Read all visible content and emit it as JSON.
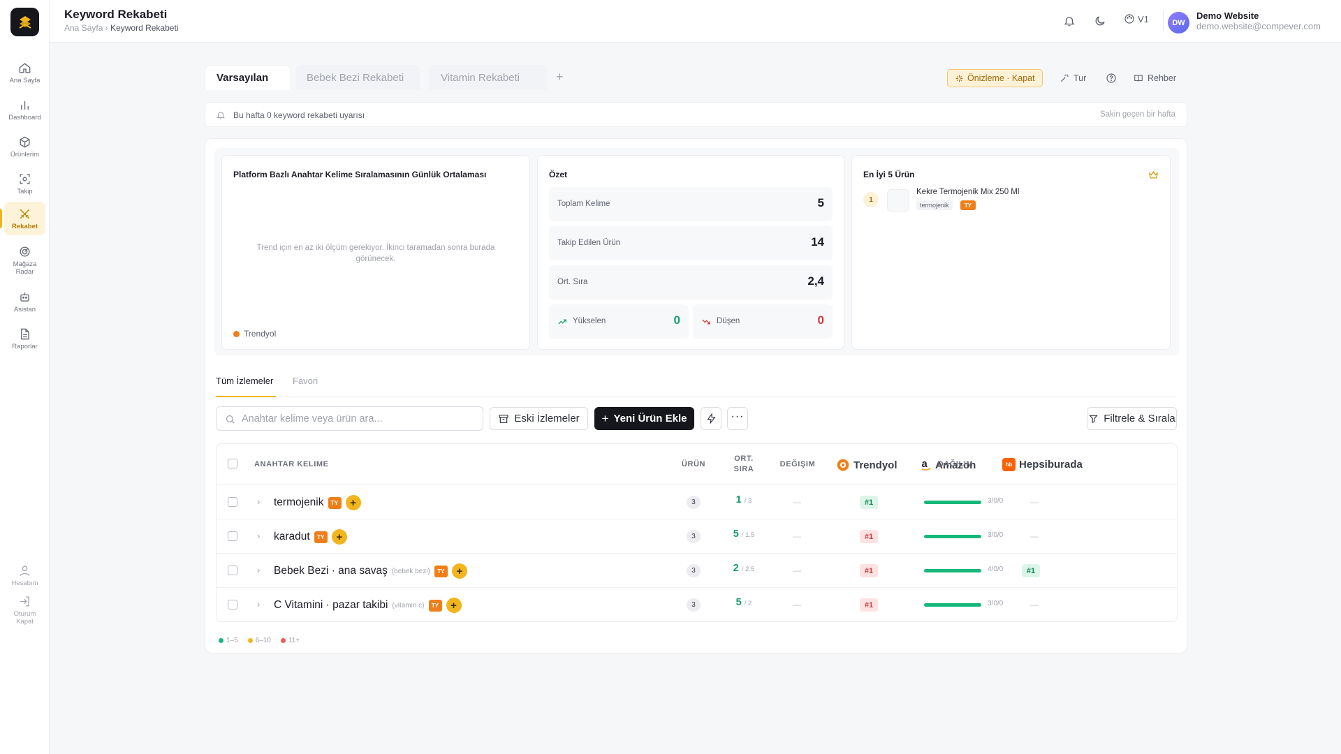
{
  "app": {
    "title": "Keyword Rekabeti"
  },
  "breadcrumb": [
    "Ana Sayfa",
    "Keyword Rekabeti"
  ],
  "sidebar": {
    "items": [
      {
        "label": "Ana Sayfa",
        "icon": "home-icon"
      },
      {
        "label": "Dashboard",
        "icon": "bar-chart-icon"
      },
      {
        "label": "Ürünlerim",
        "icon": "box-icon"
      },
      {
        "label": "Takip",
        "icon": "scan-icon"
      },
      {
        "label": "Rekabet",
        "icon": "swords-icon",
        "active": true
      },
      {
        "label": "Mağaza Radar",
        "icon": "radar-icon"
      },
      {
        "label": "Asistan",
        "icon": "bot-icon"
      },
      {
        "label": "Raporlar",
        "icon": "file-icon"
      }
    ],
    "bottom": [
      {
        "label": "Hesabım",
        "icon": "user-icon"
      },
      {
        "label": "Oturum Kapat",
        "icon": "logout-icon"
      }
    ]
  },
  "topbar": {
    "lang": "V1",
    "user_initials": "DW",
    "user_name": "Demo Website",
    "user_email": "demo.website@compever.com"
  },
  "view_tabs": [
    "Varsayılan",
    "Bebek Bezi Rekabeti",
    "Vitamin Rekabeti"
  ],
  "actions": {
    "preview": "Önizleme · Kapat",
    "tour": "Tur",
    "guide": "Rehber"
  },
  "alert": {
    "text": "Bu hafta 0 keyword rekabeti uyarısı",
    "sub": "Sakin geçen bir hafta"
  },
  "chart_panel": {
    "title": "Platform Bazlı Anahtar Kelime Sıralamasının Günlük Ortalaması",
    "empty": "Trend için en az iki ölçüm gerekiyor. İkinci taramadan sonra burada görünecek.",
    "legend": "Trendyol"
  },
  "summary": {
    "title": "Özet",
    "total_label": "Toplam Kelime",
    "total": "5",
    "tracked_label": "Takip Edilen Ürün",
    "tracked": "14",
    "avg_label": "Ort. Sıra",
    "avg": "2,4",
    "up_label": "Yükselen",
    "up": "0",
    "down_label": "Düşen",
    "down": "0"
  },
  "top5": {
    "title": "En İyi 5 Ürün",
    "items": [
      {
        "rank": "1",
        "name": "Kekre Termojenik Mix 250 Ml",
        "keyword": "termojenik",
        "platform": "TY"
      }
    ]
  },
  "sub_tabs": [
    "Tüm İzlemeler",
    "Favori"
  ],
  "toolbar": {
    "search_placeholder": "Anahtar kelime veya ürün ara...",
    "archive": "Eski İzlemeler",
    "add": "Yeni Ürün Ekle",
    "filter": "Filtrele & Sırala"
  },
  "table": {
    "headers": {
      "keyword": "ANAHTAR KELIME",
      "product": "ÜRÜN",
      "avg1": "ORT.",
      "avg2": "SIRA",
      "change": "DEĞIŞIM",
      "distribution": "DAĞILIM"
    },
    "platforms": [
      "Trendyol",
      "Amazon",
      "Hepsiburada"
    ],
    "rows": [
      {
        "keyword": "termojenik",
        "tag": "",
        "count": "3",
        "avg": "1",
        "avg_total": "/ 3",
        "change": "—",
        "trendyol": "#1",
        "ty_class": "g",
        "amazon": "—",
        "hepsiburada": "—",
        "dist": "3/0/0"
      },
      {
        "keyword": "karadut",
        "tag": "",
        "count": "3",
        "avg": "5",
        "avg_total": "/ 1.5",
        "change": "—",
        "trendyol": "#1",
        "ty_class": "r",
        "amazon": "—",
        "hepsiburada": "—",
        "dist": "3/0/0"
      },
      {
        "keyword": "Bebek Bezi · ana savaş",
        "tag": "(bebek bezi)",
        "count": "3",
        "avg": "2",
        "avg_total": "/ 2.5",
        "change": "—",
        "trendyol": "#1",
        "ty_class": "r",
        "amazon": "—",
        "hepsiburada": "#1",
        "dist": "4/0/0"
      },
      {
        "keyword": "C Vitamini · pazar takibi",
        "tag": "(vitamin c)",
        "count": "3",
        "avg": "5",
        "avg_total": "/ 2",
        "change": "—",
        "trendyol": "#1",
        "ty_class": "r",
        "amazon": "—",
        "hepsiburada": "—",
        "dist": "3/0/0"
      }
    ]
  },
  "legend": [
    "1–5",
    "6–10",
    "11+"
  ],
  "colors": {
    "accent": "#f2b51c",
    "green": "#16a06a",
    "red": "#d23a3a",
    "trendyol": "#f07f19"
  }
}
